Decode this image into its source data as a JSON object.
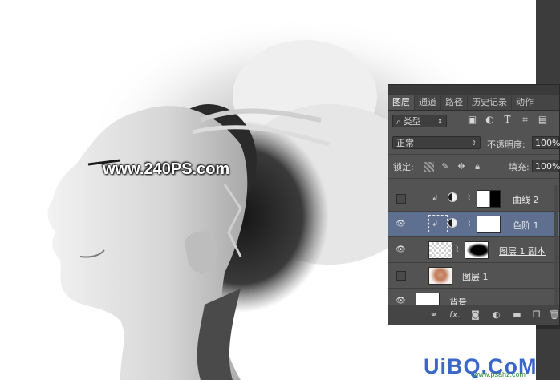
{
  "watermark": "www.240PS.com",
  "logo": {
    "text": "UiBQ.CoM",
    "sub": "www.psahz.com"
  },
  "panel": {
    "tabs": [
      "图层",
      "通道",
      "路径",
      "历史记录",
      "动作"
    ],
    "filter_select": "类型",
    "filter_icons": [
      "image-filter-icon",
      "adjustment-filter-icon",
      "text-filter-icon",
      "shape-filter-icon",
      "smart-object-filter-icon"
    ],
    "blend_mode": "正常",
    "opacity_label": "不透明度:",
    "opacity_value": "100%",
    "lock_label": "锁定:",
    "fill_label": "填充:",
    "fill_value": "100%",
    "layers": [
      {
        "name": "曲线 2",
        "visible": false,
        "selected": false
      },
      {
        "name": "色阶 1",
        "visible": true,
        "selected": true
      },
      {
        "name": "图层 1 副本",
        "visible": true,
        "selected": false
      },
      {
        "name": "图层 1",
        "visible": false,
        "selected": false
      },
      {
        "name": "背景",
        "visible": true,
        "selected": false
      }
    ],
    "bottom_icons": [
      "link-icon",
      "fx-icon",
      "mask-icon",
      "adjustment-icon",
      "folder-icon",
      "new-layer-icon",
      "trash-icon"
    ],
    "fx_label": "fx."
  }
}
